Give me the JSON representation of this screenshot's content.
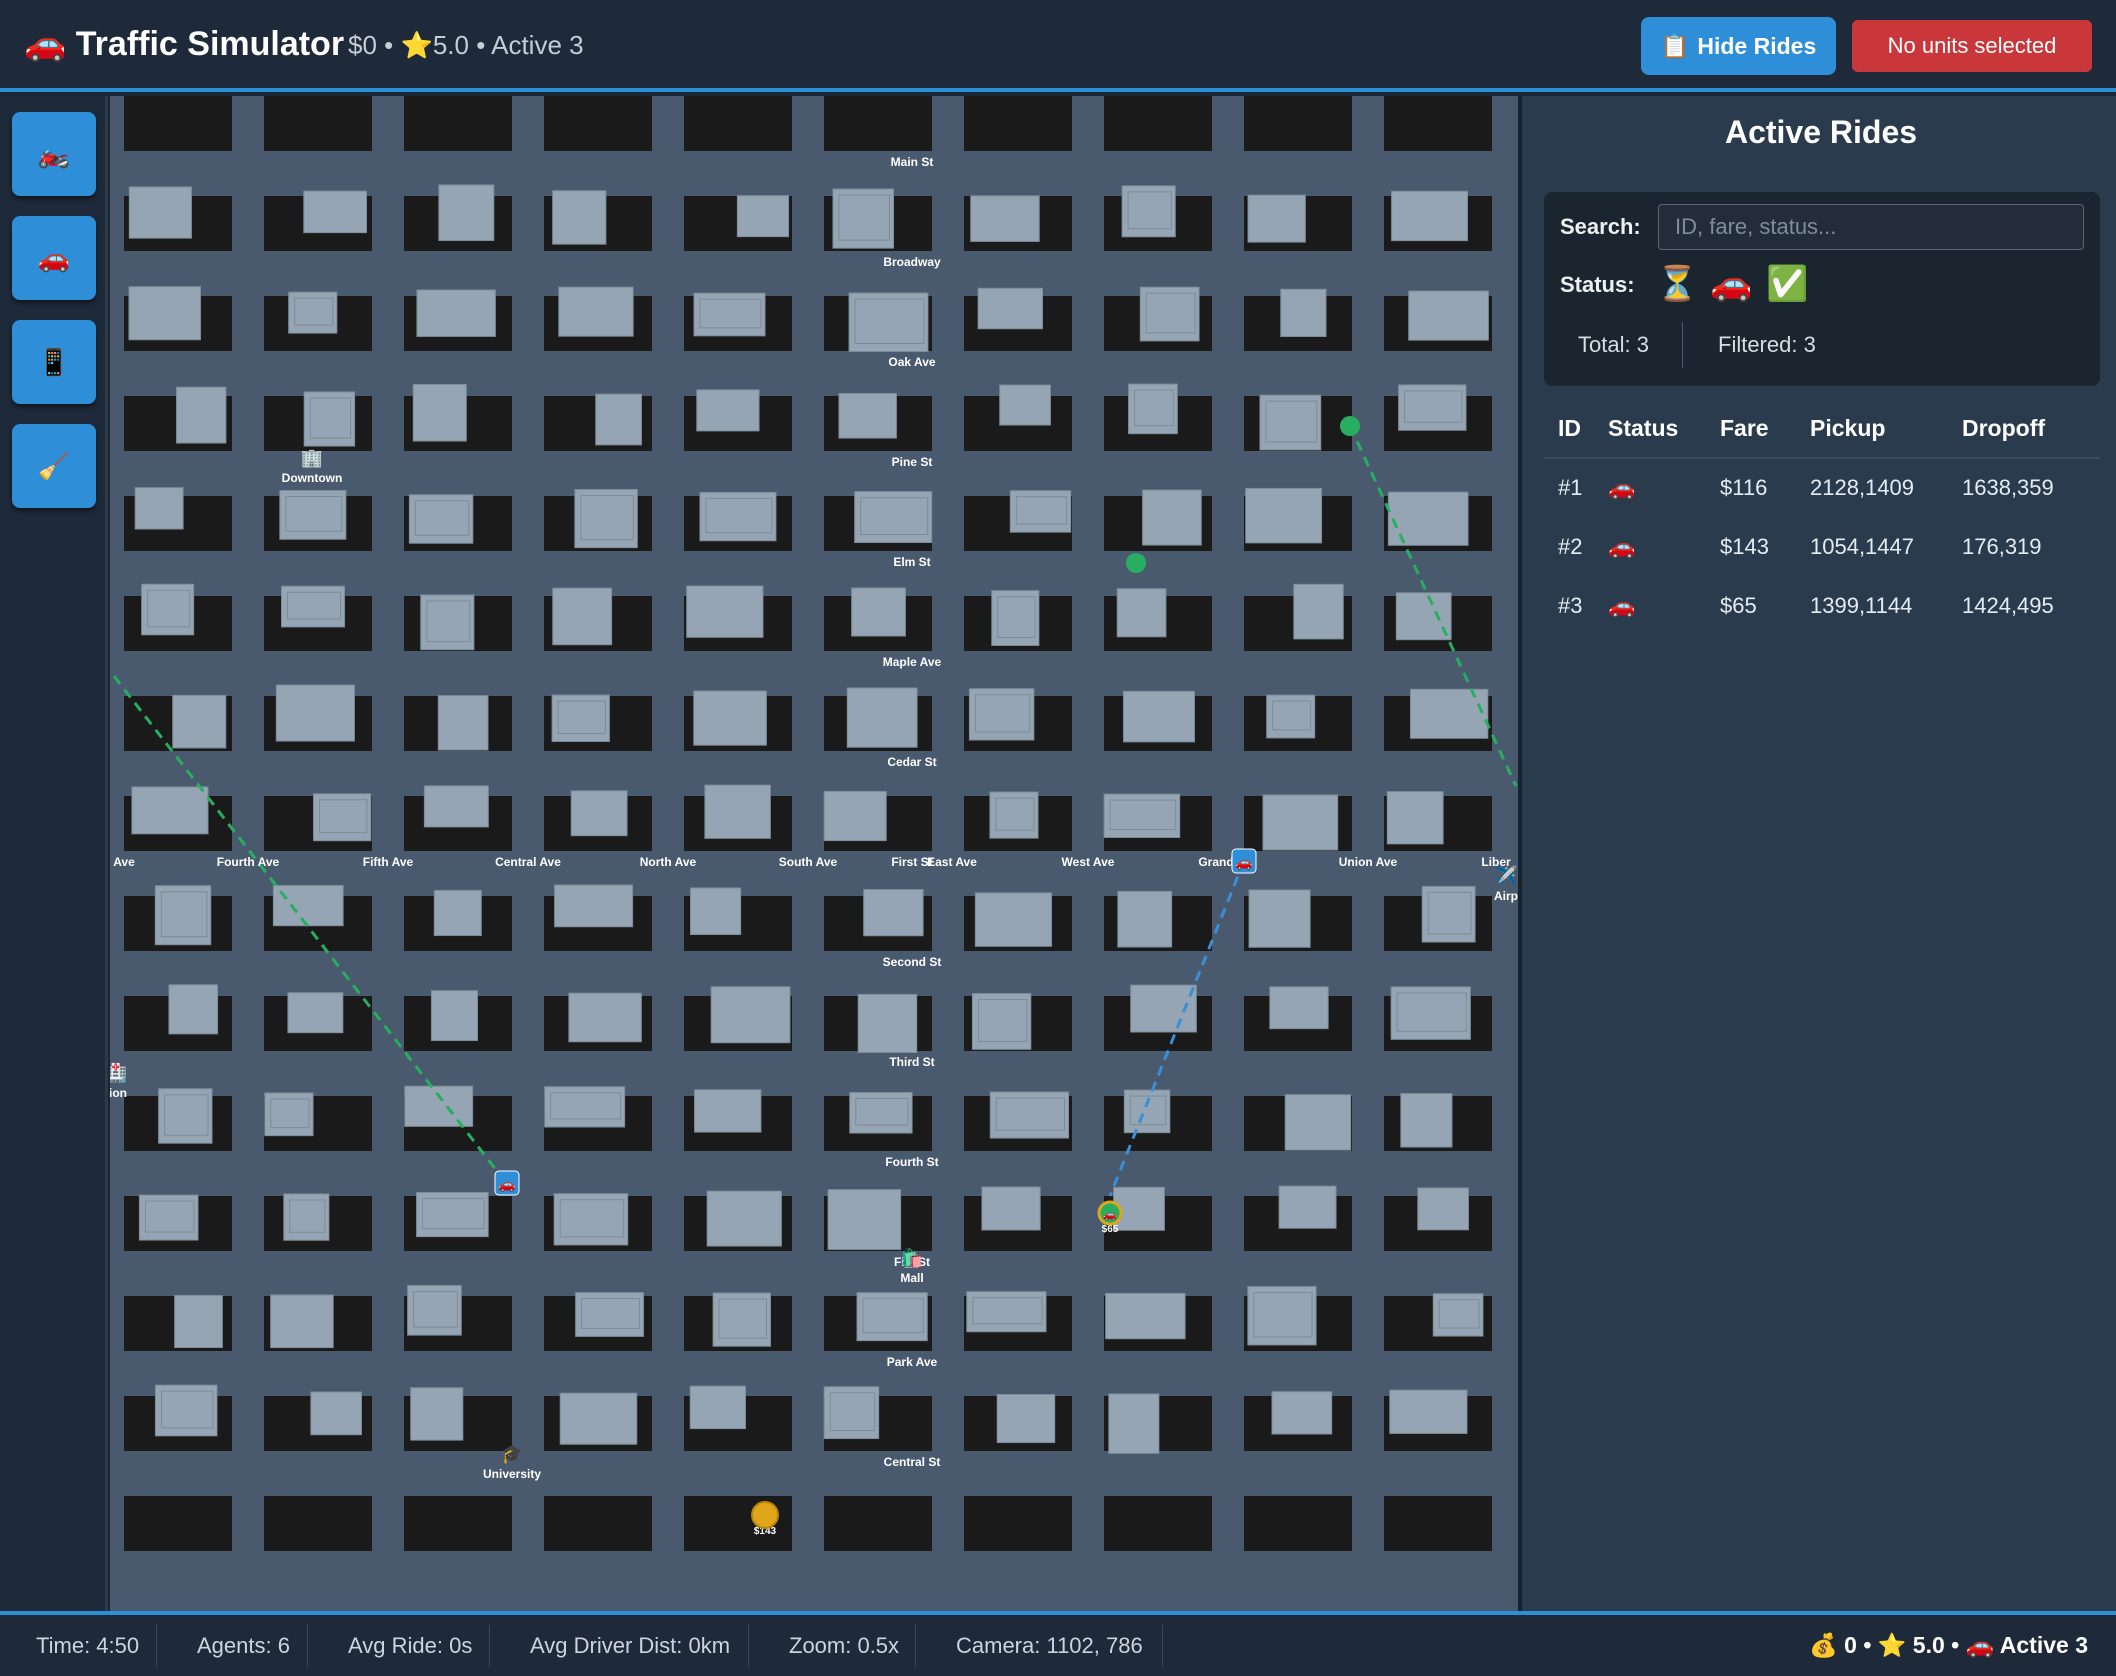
{
  "header": {
    "title": "🚗 Traffic Simulator",
    "stats": "$0 • ⭐5.0 • Active 3",
    "hide_rides_icon": "📋",
    "hide_rides_label": "Hide Rides",
    "units_label": "No units selected"
  },
  "toolbar": {
    "buttons": [
      {
        "icon": "🏍️",
        "name": "motorcycle-icon"
      },
      {
        "icon": "🚗",
        "name": "car-icon"
      },
      {
        "icon": "📱",
        "name": "phone-icon"
      },
      {
        "icon": "🧹",
        "name": "broom-icon"
      }
    ]
  },
  "map": {
    "street_labels_h": [
      "Main St",
      "Broadway",
      "Oak Ave",
      "Pine St",
      "Elm St",
      "Maple Ave",
      "Cedar St",
      "Second St",
      "Third St",
      "Fourth St",
      "Fi__St",
      "Park Ave",
      "Central St"
    ],
    "avenue_labels": [
      "Ave",
      "Fourth Ave",
      "Fifth Ave",
      "Central Ave",
      "North Ave",
      "South Ave",
      "First St",
      "East Ave",
      "West Ave",
      "Grand",
      "Union Ave",
      "Liber"
    ],
    "landmarks": [
      {
        "icon": "🏢",
        "label": "Downtown"
      },
      {
        "icon": "🏥",
        "label": "tion"
      },
      {
        "icon": "🛍️",
        "label": "Mall"
      },
      {
        "icon": "🎓",
        "label": "University"
      },
      {
        "icon": "✈️",
        "label": "Airp"
      }
    ],
    "fare_tags": [
      "$65",
      "$143"
    ]
  },
  "panel": {
    "title": "Active Rides",
    "search_label": "Search:",
    "search_placeholder": "ID, fare, status...",
    "status_label": "Status:",
    "status_icons": [
      "⏳",
      "🚗",
      "✅"
    ],
    "total": "Total: 3",
    "filtered": "Filtered: 3",
    "columns": [
      "ID",
      "Status",
      "Fare",
      "Pickup",
      "Dropoff"
    ],
    "rides": [
      {
        "id": "#1",
        "status": "🚗",
        "fare": "$116",
        "pickup": "2128,1409",
        "dropoff": "1638,359"
      },
      {
        "id": "#2",
        "status": "🚗",
        "fare": "$143",
        "pickup": "1054,1447",
        "dropoff": "176,319"
      },
      {
        "id": "#3",
        "status": "🚗",
        "fare": "$65",
        "pickup": "1399,1144",
        "dropoff": "1424,495"
      }
    ]
  },
  "footer": {
    "time": "Time: 4:50",
    "agents": "Agents: 6",
    "avg_ride": "Avg Ride: 0s",
    "avg_driver_dist": "Avg Driver Dist: 0km",
    "zoom": "Zoom: 0.5x",
    "camera": "Camera: 1102, 786",
    "summary": "💰 0 • ⭐ 5.0 • 🚗 Active 3"
  },
  "colors": {
    "accent": "#2d8fd6",
    "danger": "#c9373a",
    "road": "#4a5a6e",
    "block": "#1a1a1a",
    "building": "#95a5b3",
    "route_green": "#27ae60",
    "route_blue": "#3a8fd6",
    "fare_coin": "#e0a61a"
  }
}
